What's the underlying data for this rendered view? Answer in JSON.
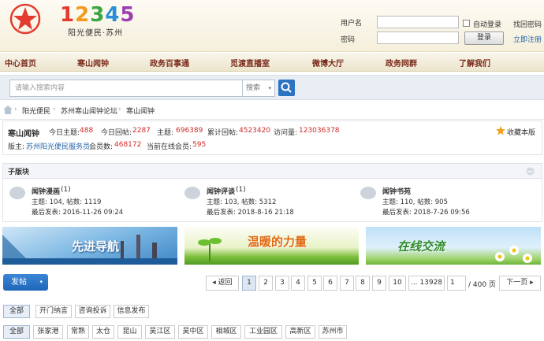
{
  "header": {
    "logo_number": [
      "1",
      "2",
      "3",
      "4",
      "5"
    ],
    "logo_subtitle": "阳光便民·苏州",
    "username_label": "用户名",
    "password_label": "密码",
    "auto_login_label": "自动登录",
    "forgot_password": "找回密码",
    "login_button": "登录",
    "register_link": "立即注册"
  },
  "nav": {
    "items": [
      "中心首页",
      "寒山闻钟",
      "政务百事通",
      "觅渡直播室",
      "微博大厅",
      "政务网群",
      "了解我们"
    ]
  },
  "search": {
    "placeholder": "请输入搜索内容",
    "scope": "搜索"
  },
  "breadcrumb": [
    "阳光便民",
    "苏州寒山闻钟论坛",
    "寒山闻钟"
  ],
  "forum": {
    "name": "寒山闻钟",
    "today_posts_label": "今日主题:",
    "today_posts": "488",
    "today_replies_label": "今日回帖:",
    "today_replies": "2287",
    "topics_label": "主题:",
    "topics": "696389",
    "total_replies_label": "累计回帖:",
    "total_replies": "4523420",
    "visits_label": "访问量:",
    "visits": "123036378",
    "favorite": "收藏本版",
    "moderator_label": "版主:",
    "moderator": "苏州阳光便民服务员",
    "members_label": "会员数:",
    "members": "468172",
    "online_label": "当前在线会员:",
    "online": "595"
  },
  "subboards": {
    "title": "子版块",
    "items": [
      {
        "name": "闻钟漫画",
        "count": "(1)",
        "stats": "主题: 104, 帖数: 1119",
        "last": "最后发表: 2016-11-26 09:24"
      },
      {
        "name": "闻钟评谈",
        "count": "(1)",
        "stats": "主题: 103, 帖数: 5312",
        "last": "最后发表: 2018-8-16 21:18"
      },
      {
        "name": "闻钟书苑",
        "count": "",
        "stats": "主题: 110, 帖数: 905",
        "last": "最后发表: 2018-7-26 09:56"
      }
    ]
  },
  "banners": [
    "先进导航",
    "温暖的力量",
    "在线交流"
  ],
  "pager": {
    "post_button": "发帖",
    "back": "◂ 返回",
    "pages": [
      "1",
      "2",
      "3",
      "4",
      "5",
      "6",
      "7",
      "8",
      "9",
      "10"
    ],
    "last_page": "... 13928",
    "current_input": "1",
    "total": "/ 400 页",
    "next": "下一页 ▸"
  },
  "filters": {
    "row1": [
      "全部",
      "开门纳言",
      "咨询投诉",
      "信息发布"
    ],
    "row2": [
      "全部",
      "张家港",
      "常熟",
      "太仓",
      "昆山",
      "吴江区",
      "吴中区",
      "相城区",
      "工业园区",
      "高新区",
      "苏州市"
    ]
  },
  "colors": {
    "accent": "#2c73c2",
    "highlight_red": "#d12d2d",
    "nav_text": "#7a2a1a"
  }
}
